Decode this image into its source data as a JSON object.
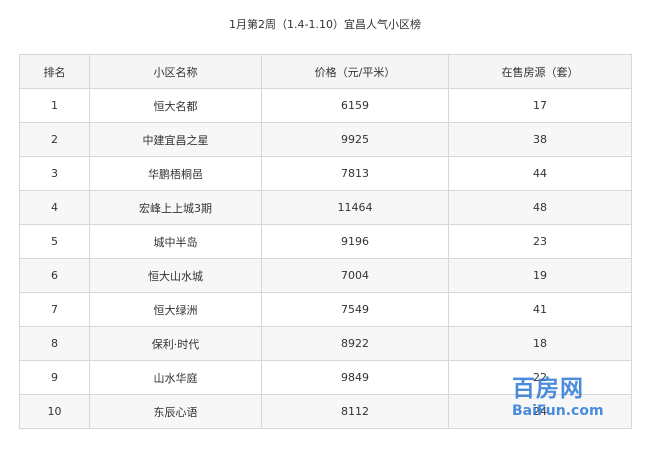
{
  "title": "1月第2周（1.4-1.10）宜昌人气小区榜",
  "table": {
    "headers": [
      "排名",
      "小区名称",
      "价格（元/平米）",
      "在售房源（套）"
    ],
    "rows": [
      [
        "1",
        "恒大名都",
        "6159",
        "17"
      ],
      [
        "2",
        "中建宜昌之星",
        "9925",
        "38"
      ],
      [
        "3",
        "华鹏梧桐邑",
        "7813",
        "44"
      ],
      [
        "4",
        "宏峰上上城3期",
        "11464",
        "48"
      ],
      [
        "5",
        "城中半岛",
        "9196",
        "23"
      ],
      [
        "6",
        "恒大山水城",
        "7004",
        "19"
      ],
      [
        "7",
        "恒大绿洲",
        "7549",
        "41"
      ],
      [
        "8",
        "保利·时代",
        "8922",
        "18"
      ],
      [
        "9",
        "山水华庭",
        "9849",
        "22"
      ],
      [
        "10",
        "东辰心语",
        "8112",
        "24"
      ]
    ]
  },
  "watermark": {
    "main": "百房网",
    "sub": "BaiFun.com",
    "color": "#2d78d7"
  }
}
